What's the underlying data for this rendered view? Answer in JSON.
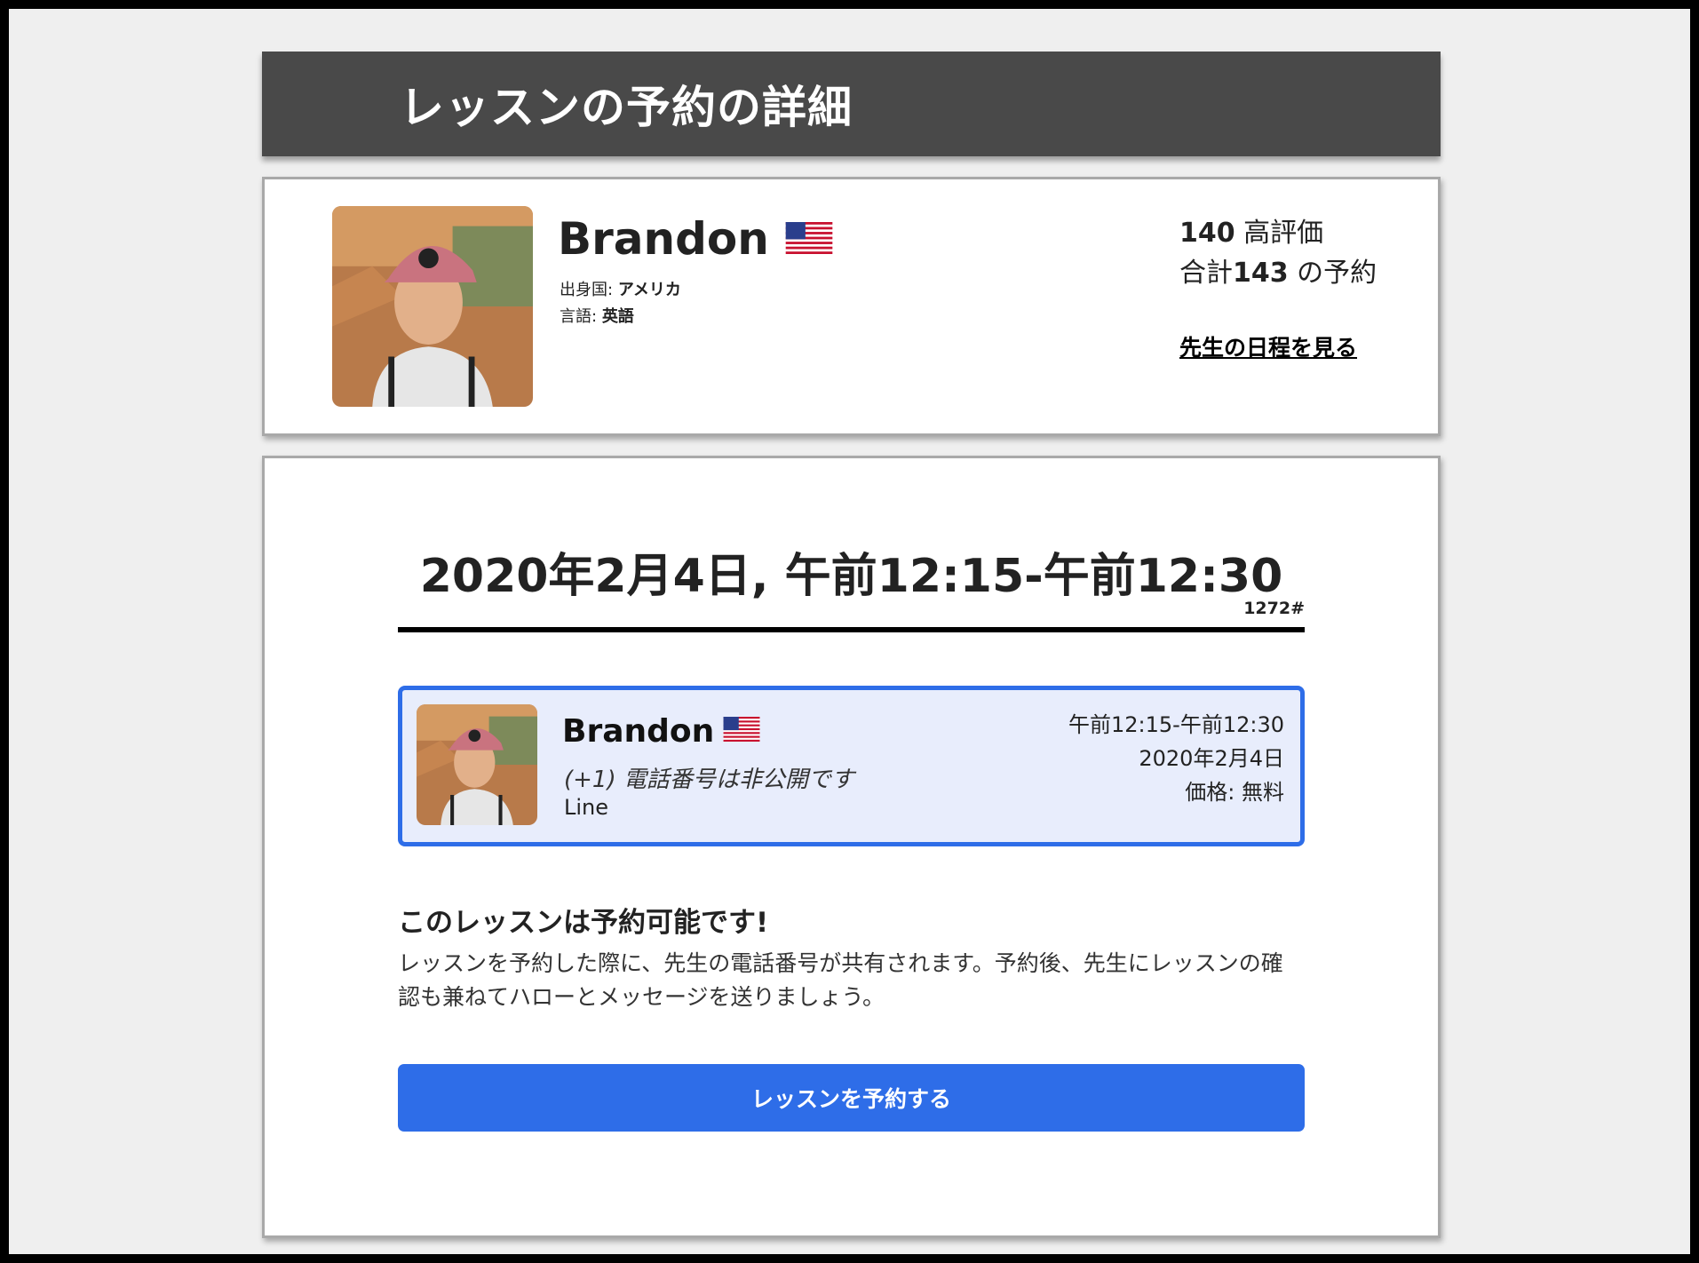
{
  "header": {
    "title": "レッスンの予約の詳細"
  },
  "teacher": {
    "name": "Brandon",
    "flag": "us-flag-icon",
    "country_label": "出身国:",
    "country": "アメリカ",
    "language_label": "言語:",
    "language": "英語",
    "positive_count": "140",
    "positive_label": "高評価",
    "total_prefix": "合計",
    "total_count": "143",
    "total_suffix": "の予約",
    "schedule_link": "先生の日程を見る"
  },
  "lesson": {
    "datetime": "2020年2月4日, 午前12:15-午前12:30",
    "id": "1272#"
  },
  "booking": {
    "name": "Brandon",
    "phone": "(+1) 電話番号は非公開です",
    "contact": "Line",
    "time": "午前12:15-午前12:30",
    "date": "2020年2月4日",
    "price": "価格: 無料"
  },
  "availability": {
    "title": "このレッスンは予約可能です!",
    "description": "レッスンを予約した際に、先生の電話番号が共有されます。予約後、先生にレッスンの確認も兼ねてハローとメッセージを送りましょう。"
  },
  "book_button": "レッスンを予約する",
  "colors": {
    "accent": "#2e6de8",
    "header_bg": "#494949",
    "booking_bg": "#e8edfc"
  }
}
